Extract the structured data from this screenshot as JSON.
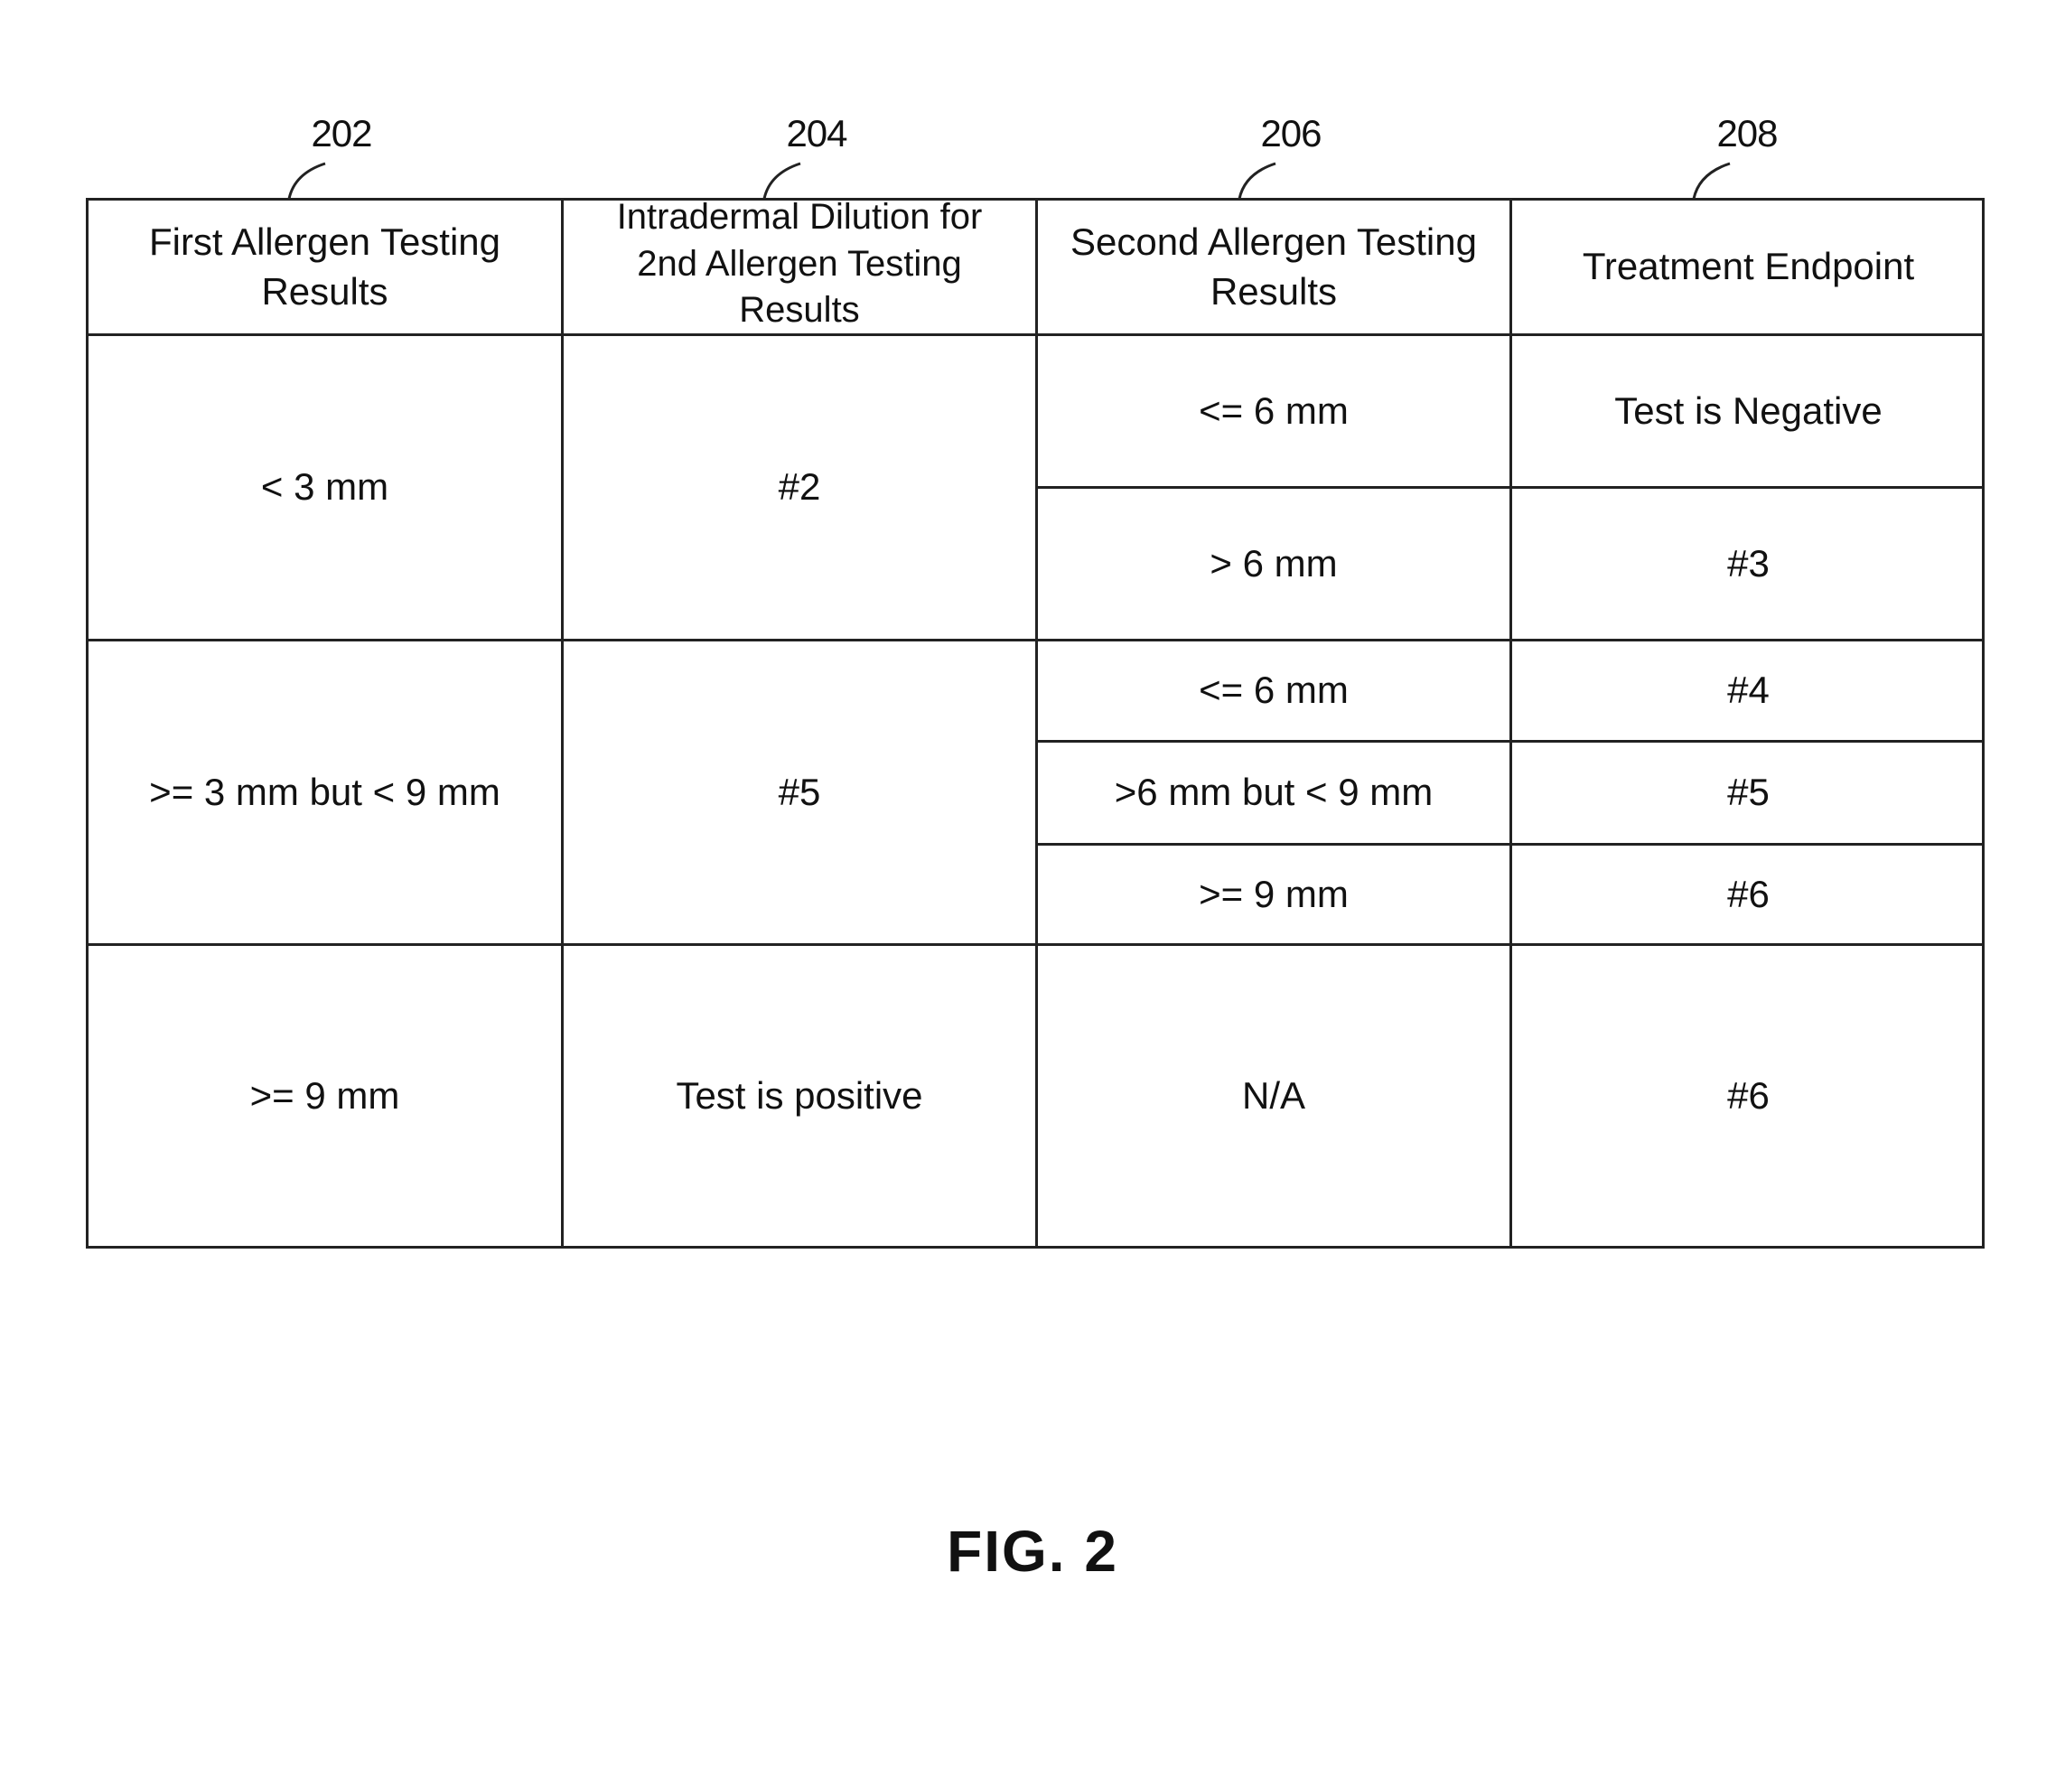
{
  "figure": {
    "label": "FIG. 2",
    "reference_numerals": [
      "202",
      "204",
      "206",
      "208"
    ]
  },
  "table": {
    "headers": [
      "First Allergen Testing Results",
      "Intradermal Dilution for 2nd Allergen Testing Results",
      "Second Allergen Testing Results",
      "Treatment Endpoint"
    ],
    "groups": [
      {
        "first_result": "< 3 mm",
        "dilution": "#2",
        "outcomes": [
          {
            "second_result": "<= 6 mm",
            "endpoint": "Test is Negative"
          },
          {
            "second_result": "> 6 mm",
            "endpoint": "#3"
          }
        ]
      },
      {
        "first_result": ">= 3 mm but < 9 mm",
        "dilution": "#5",
        "outcomes": [
          {
            "second_result": "<= 6 mm",
            "endpoint": "#4"
          },
          {
            "second_result": ">6 mm but < 9 mm",
            "endpoint": "#5"
          },
          {
            "second_result": ">= 9 mm",
            "endpoint": "#6"
          }
        ]
      },
      {
        "first_result": ">= 9 mm",
        "dilution": "Test is positive",
        "outcomes": [
          {
            "second_result": "N/A",
            "endpoint": "#6"
          }
        ]
      }
    ]
  }
}
